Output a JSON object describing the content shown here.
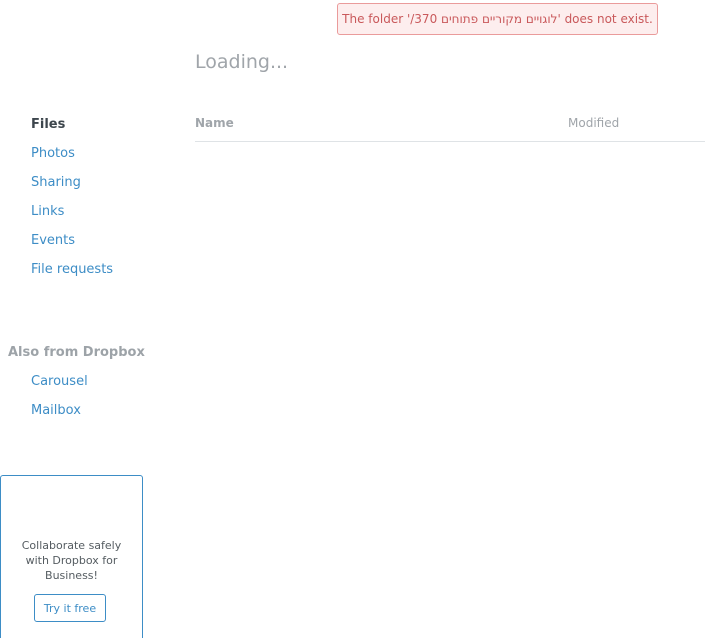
{
  "notification": {
    "error_text": "The folder '/370 לוגויים מקוריים פתוחים' does not exist."
  },
  "main": {
    "loading_text": "Loading...",
    "columns": {
      "name": "Name",
      "modified": "Modified"
    }
  },
  "sidebar": {
    "items": [
      {
        "label": "Files",
        "active": true
      },
      {
        "label": "Photos"
      },
      {
        "label": "Sharing"
      },
      {
        "label": "Links"
      },
      {
        "label": "Events"
      },
      {
        "label": "File requests"
      }
    ],
    "also_from": {
      "label": "Also from Dropbox",
      "items": [
        {
          "label": "Carousel"
        },
        {
          "label": "Mailbox"
        }
      ]
    }
  },
  "promo": {
    "text": "Collaborate safely with Dropbox for Business!",
    "button_label": "Try it free"
  },
  "colors": {
    "link_blue": "#3d8dc6",
    "error_red": "#c9595b",
    "muted_gray": "#a0a5aa"
  }
}
